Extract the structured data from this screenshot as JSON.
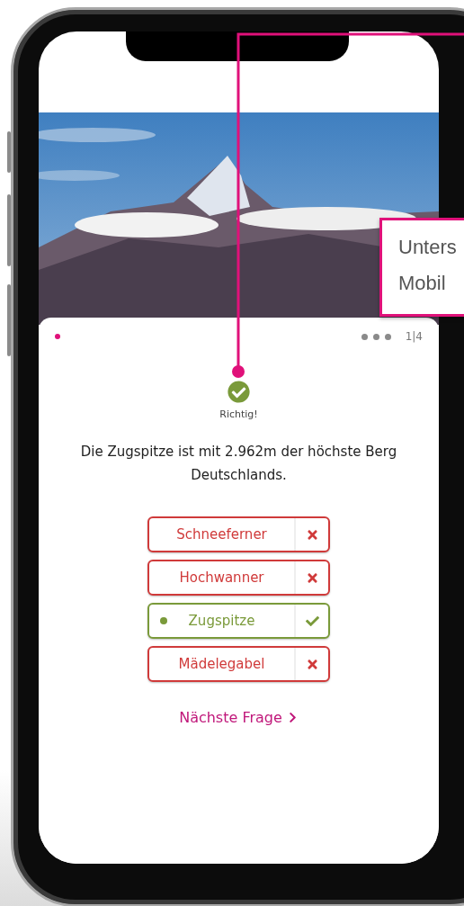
{
  "progress": {
    "dots": [
      {
        "selected": true
      },
      {
        "selected": false
      },
      {
        "selected": false
      },
      {
        "selected": false
      }
    ],
    "counter": "1|4"
  },
  "result": {
    "kind": "correct",
    "label": "Richtig!"
  },
  "question": "Die Zugspitze ist mit 2.962m der höchste Berg Deutschlands.",
  "answers": [
    {
      "label": "Schneeferner",
      "kind": "wrong",
      "selected": false
    },
    {
      "label": "Hochwanner",
      "kind": "wrong",
      "selected": false
    },
    {
      "label": "Zugspitze",
      "kind": "correct",
      "selected": true
    },
    {
      "label": "Mädelegabel",
      "kind": "wrong",
      "selected": false
    }
  ],
  "next_link": "Nächste Frage",
  "callout": {
    "lines": [
      "Unters",
      "Mobil"
    ]
  }
}
